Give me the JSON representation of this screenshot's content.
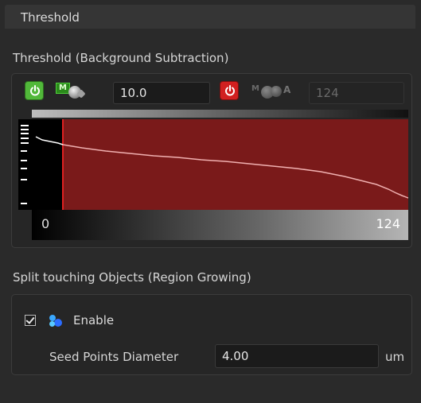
{
  "panel": {
    "title": "Threshold"
  },
  "threshold": {
    "section_label": "Threshold (Background Subtraction)",
    "low_value": "10.0",
    "high_value": "124",
    "manual_badge": "M",
    "auto_badge_m": "M",
    "auto_badge_a": "A",
    "range_min": "0",
    "range_max": "124",
    "fill_color": "#7a1a1a",
    "curve_color": "#f0b0b0",
    "threshold_line_color": "#e02020",
    "threshold_fraction": 0.08
  },
  "split": {
    "section_label": "Split touching Objects (Region Growing)",
    "enable_label": "Enable",
    "enable_checked": true,
    "seed_label": "Seed Points Diameter",
    "seed_value": "4.00",
    "seed_unit": "um"
  },
  "icons": {
    "power_on": "power-on-icon",
    "power_off": "power-off-icon",
    "enable": "region-growing-icon"
  }
}
